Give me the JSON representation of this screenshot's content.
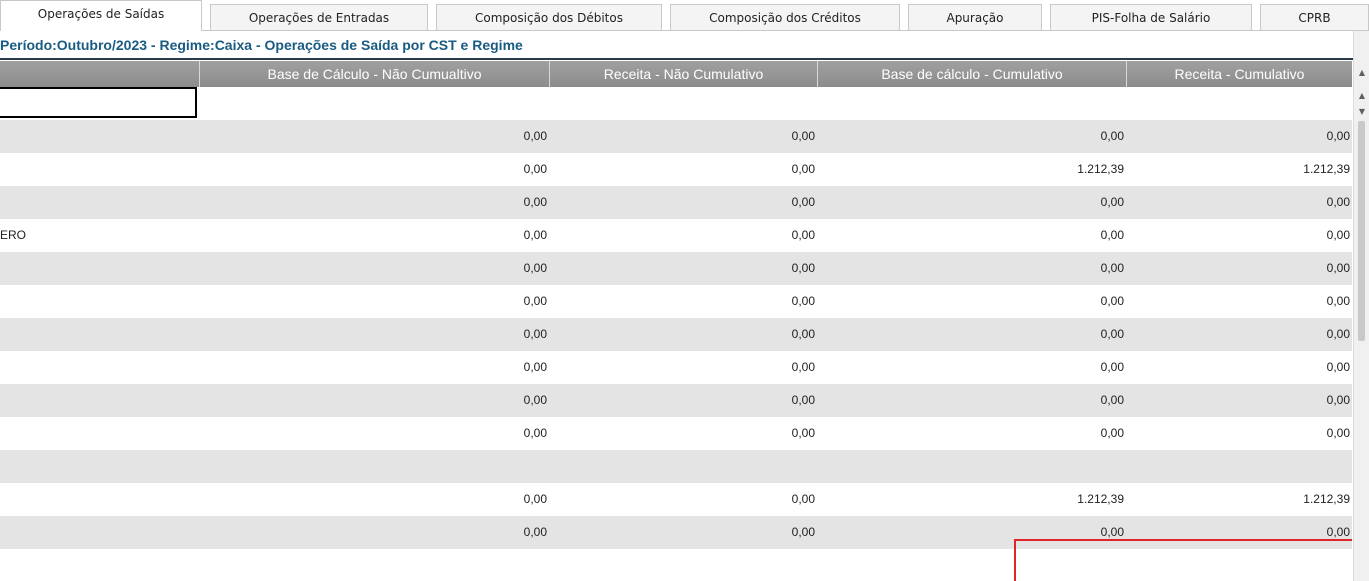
{
  "tabs": [
    {
      "label": "Operações de Saídas",
      "active": true
    },
    {
      "label": "Operações de Entradas",
      "active": false
    },
    {
      "label": "Composição dos Débitos",
      "active": false
    },
    {
      "label": "Composição dos Créditos",
      "active": false
    },
    {
      "label": "Apuração",
      "active": false
    },
    {
      "label": "PIS-Folha de Salário",
      "active": false
    },
    {
      "label": "CPRB",
      "active": false
    }
  ],
  "period_title": "Período:Outubro/2023 - Regime:Caixa - Operações de Saída por CST e Regime",
  "table": {
    "headers": [
      "",
      "Base de Cálculo - Não Cumualtivo",
      "Receita - Não Cumulativo",
      "Base de cálculo - Cumulativo",
      "Receita - Cumulativo"
    ],
    "rows": [
      {
        "label": "",
        "values": [
          "0,00",
          "0,00",
          "0,00",
          "0,00"
        ]
      },
      {
        "label": "",
        "values": [
          "0,00",
          "0,00",
          "1.212,39",
          "1.212,39"
        ]
      },
      {
        "label": "",
        "values": [
          "0,00",
          "0,00",
          "0,00",
          "0,00"
        ]
      },
      {
        "label": "ERO",
        "values": [
          "0,00",
          "0,00",
          "0,00",
          "0,00"
        ]
      },
      {
        "label": "",
        "values": [
          "0,00",
          "0,00",
          "0,00",
          "0,00"
        ]
      },
      {
        "label": "",
        "values": [
          "0,00",
          "0,00",
          "0,00",
          "0,00"
        ]
      },
      {
        "label": "",
        "values": [
          "0,00",
          "0,00",
          "0,00",
          "0,00"
        ]
      },
      {
        "label": "",
        "values": [
          "0,00",
          "0,00",
          "0,00",
          "0,00"
        ]
      },
      {
        "label": "",
        "values": [
          "0,00",
          "0,00",
          "0,00",
          "0,00"
        ]
      },
      {
        "label": "",
        "values": [
          "0,00",
          "0,00",
          "0,00",
          "0,00"
        ]
      },
      {
        "label": "",
        "values": [
          "",
          "",
          "",
          ""
        ]
      },
      {
        "label": "",
        "values": [
          "0,00",
          "0,00",
          "1.212,39",
          "1.212,39"
        ]
      },
      {
        "label": "",
        "values": [
          "0,00",
          "0,00",
          "0,00",
          "0,00"
        ]
      }
    ]
  },
  "colors": {
    "title": "#1a5b82",
    "header_bg": "#959595",
    "row_alt": "#e4e4e4",
    "highlight": "#e0242b"
  },
  "icons": {
    "scroll_up": "chevron-up-icon",
    "scroll_down": "chevron-down-icon"
  }
}
